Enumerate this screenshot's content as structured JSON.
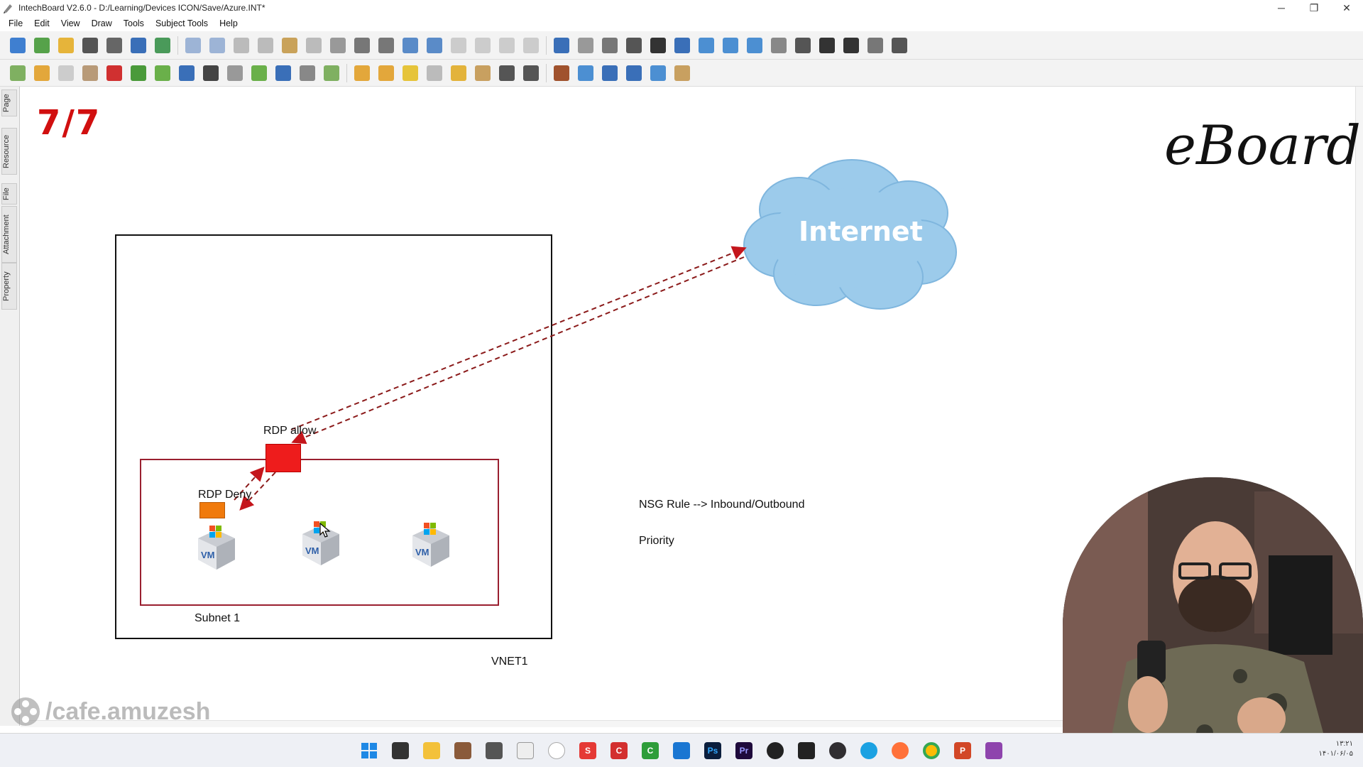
{
  "window": {
    "title": "IntechBoard V2.6.0 - D:/Learning/Devices ICON/Save/Azure.INT*",
    "minimize": "─",
    "restore": "❐",
    "close": "✕"
  },
  "menu": [
    "File",
    "Edit",
    "View",
    "Draw",
    "Tools",
    "Subject Tools",
    "Help"
  ],
  "side_tabs": [
    "Page",
    "Resource",
    "File",
    "Attachment",
    "Property"
  ],
  "canvas": {
    "page_indicator": "7/7",
    "logo": "eBoard",
    "cloud_label": "Internet",
    "rdp_allow": "RDP allow",
    "rdp_deny": "RDP Deny",
    "subnet_label": "Subnet 1",
    "vnet_label": "VNET1",
    "nsg_rule_text": "NSG Rule --> Inbound/Outbound",
    "priority_text": "Priority",
    "vm_label": "VM",
    "colors": {
      "allow_nsg": "#ee1c1c",
      "deny_nsg": "#f07a0c",
      "subnet_border": "#9a1f2f",
      "arrow": "#8b1a1a",
      "cloud": "#9ccbeb"
    }
  },
  "watermark": "/cafe.amuzesh",
  "taskbar": {
    "apps": [
      "start",
      "sticky-notes",
      "file-explorer",
      "app",
      "app",
      "intechboard",
      "itunes",
      "app-s",
      "app-c-red",
      "app-c-green",
      "app",
      "photoshop",
      "premiere",
      "app",
      "app",
      "obs",
      "edge",
      "firefox",
      "chrome",
      "powerpoint",
      "app"
    ],
    "tray_line1": "۱۳:۲۱",
    "tray_line2": "۱۴۰۱/۰۶/۰۵"
  }
}
